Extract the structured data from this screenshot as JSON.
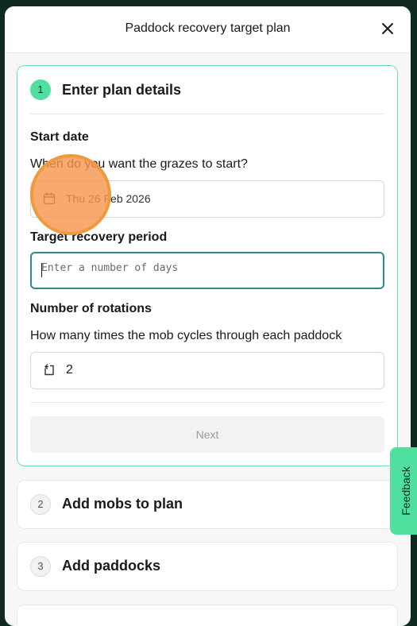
{
  "modal": {
    "title": "Paddock recovery target plan",
    "close_icon": "close-icon"
  },
  "steps": [
    {
      "number": "1",
      "title": "Enter plan details",
      "state": "active",
      "fields": {
        "start_date": {
          "label": "Start date",
          "help": "When do you want the grazes to start?",
          "value": "Thu 26 Feb 2026",
          "icon": "calendar-icon"
        },
        "target_recovery": {
          "label": "Target recovery period",
          "placeholder": "Enter a number of days",
          "value": ""
        },
        "rotations": {
          "label": "Number of rotations",
          "help": "How many times the mob cycles through each paddock",
          "value": "2",
          "icon": "rotate-icon"
        }
      },
      "next_label": "Next"
    },
    {
      "number": "2",
      "title": "Add mobs to plan",
      "state": "idle"
    },
    {
      "number": "3",
      "title": "Add paddocks",
      "state": "idle"
    }
  ],
  "feedback": {
    "label": "Feedback"
  },
  "colors": {
    "accent": "#4fe0a0",
    "active_border": "#6ee0aa",
    "focus_border": "#2f8a8a",
    "click_marker": "#f09a3e"
  }
}
